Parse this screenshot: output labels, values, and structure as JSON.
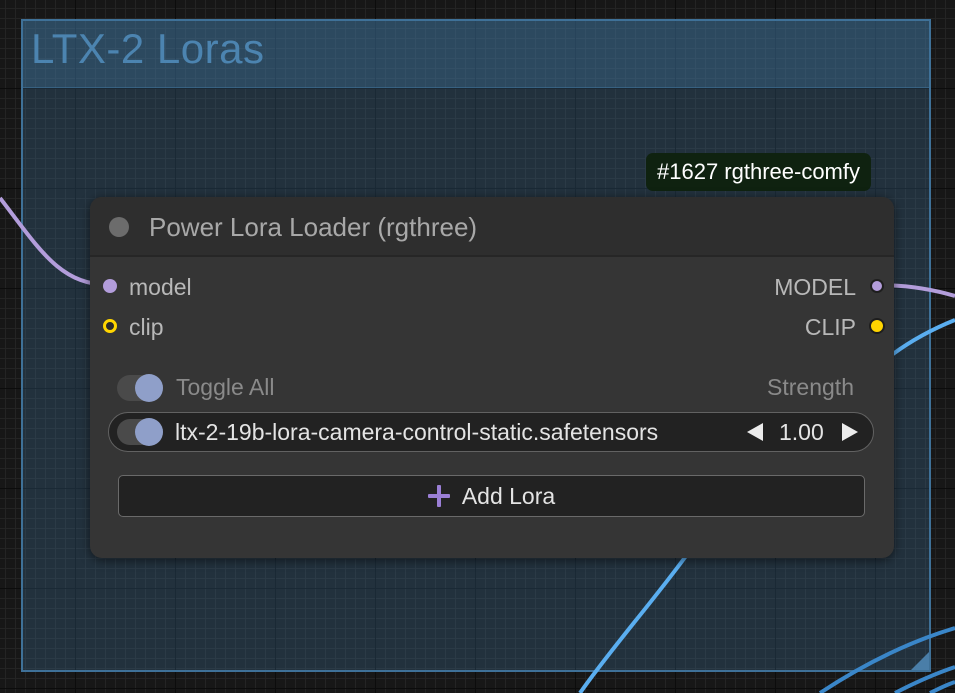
{
  "group": {
    "title": "LTX-2 Loras",
    "border_color": "#3f7198",
    "title_color": "#4c84b0"
  },
  "badge": {
    "text": "#1627 rgthree-comfy"
  },
  "node": {
    "title": "Power Lora Loader (rgthree)",
    "inputs": [
      {
        "label": "model",
        "type_color": "#b39ddb"
      },
      {
        "label": "clip",
        "type_color": "#ffd500"
      }
    ],
    "outputs": [
      {
        "label": "MODEL",
        "type_color": "#b39ddb"
      },
      {
        "label": "CLIP",
        "type_color": "#ffd500"
      }
    ],
    "toggle_all_label": "Toggle All",
    "strength_header": "Strength",
    "loras": [
      {
        "name": "ltx-2-19b-lora-camera-control-static.safetensors",
        "strength": "1.00",
        "enabled": true
      }
    ],
    "add_lora_label": "Add Lora",
    "add_icon_color": "#9b7fd6"
  },
  "wire_colors": {
    "model": "#b39ddb",
    "clip": "#5aaef0",
    "other": "#3a86c8"
  }
}
